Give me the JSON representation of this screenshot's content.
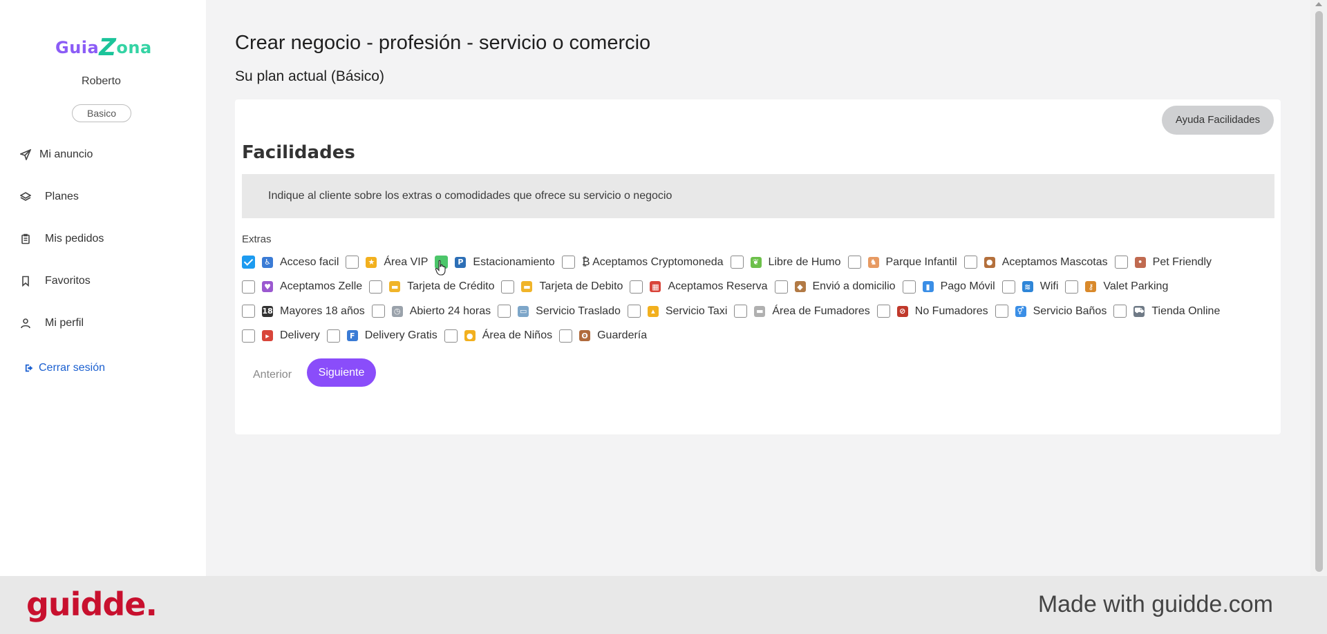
{
  "sidebar": {
    "logo": {
      "part1": "Guia",
      "part2": "Z",
      "part3": "ona"
    },
    "user_name": "Roberto",
    "plan_badge": "Basico",
    "nav": [
      {
        "label": "Mi anuncio",
        "icon": "send-icon"
      },
      {
        "label": "Planes",
        "icon": "layers-icon"
      },
      {
        "label": "Mis pedidos",
        "icon": "clipboard-icon"
      },
      {
        "label": "Favoritos",
        "icon": "bookmark-icon"
      },
      {
        "label": "Mi perfil",
        "icon": "user-icon"
      }
    ],
    "logout": "Cerrar sesión"
  },
  "main": {
    "title": "Crear negocio - profesión - servicio o comercio",
    "plan_line": "Su plan actual (Básico)",
    "help_button": "Ayuda Facilidades",
    "section_title": "Facilidades",
    "info": "Indique al cliente sobre los extras o comodidades que ofrece su servicio o negocio",
    "extras_label": "Extras",
    "rows": [
      [
        {
          "label": "Acceso facil",
          "checked": true,
          "icon": "wheelchair-icon",
          "color": "#3a7bd5",
          "glyph": "♿"
        },
        {
          "label": "Área VIP",
          "checked": false,
          "icon": "star-icon",
          "color": "#f2b01e",
          "glyph": "★"
        },
        {
          "label": "Estacionamiento",
          "checked": false,
          "hover": true,
          "icon": "parking-icon",
          "color": "#2d6fb6",
          "glyph": "P"
        },
        {
          "label": "₿ Aceptamos Cryptomoneda",
          "checked": false,
          "icon": "",
          "color": "",
          "glyph": ""
        },
        {
          "label": "Libre de Humo",
          "checked": false,
          "icon": "leaf-icon",
          "color": "#6cc04a",
          "glyph": "❦"
        },
        {
          "label": "Parque Infantil",
          "checked": false,
          "icon": "carousel-icon",
          "color": "#e79a62",
          "glyph": "♞"
        },
        {
          "label": "Aceptamos Mascotas",
          "checked": false,
          "icon": "dog-icon",
          "color": "#b4703c",
          "glyph": "●"
        },
        {
          "label": "Pet Friendly",
          "checked": false,
          "icon": "paw-icon",
          "color": "#c06a50",
          "glyph": "•"
        }
      ],
      [
        {
          "label": "Aceptamos Zelle",
          "checked": false,
          "icon": "purple-heart-icon",
          "color": "#9b59d0",
          "glyph": "♥"
        },
        {
          "label": "Tarjeta de Crédito",
          "checked": false,
          "icon": "credit-card-icon",
          "color": "#f0b429",
          "glyph": "▬"
        },
        {
          "label": "Tarjeta de Debito",
          "checked": false,
          "icon": "credit-card-icon",
          "color": "#f0b429",
          "glyph": "▬"
        },
        {
          "label": "Aceptamos Reserva",
          "checked": false,
          "icon": "calendar-icon",
          "color": "#d9443a",
          "glyph": "▦"
        },
        {
          "label": "Envió a domicilio",
          "checked": false,
          "icon": "package-icon",
          "color": "#b27a45",
          "glyph": "◆"
        },
        {
          "label": "Pago Móvil",
          "checked": false,
          "icon": "mobile-payment-icon",
          "color": "#3a8ee6",
          "glyph": "▮"
        },
        {
          "label": "Wifi",
          "checked": false,
          "icon": "wifi-icon",
          "color": "#2f86d8",
          "glyph": "≋"
        },
        {
          "label": "Valet Parking",
          "checked": false,
          "icon": "key-icon",
          "color": "#d9892b",
          "glyph": "⚷"
        }
      ],
      [
        {
          "label": "Mayores 18 años",
          "checked": false,
          "icon": "adults-only-icon",
          "color": "#333333",
          "glyph": "18"
        },
        {
          "label": "Abierto 24 horas",
          "checked": false,
          "icon": "clock-icon",
          "color": "#9aa2ab",
          "glyph": "◷"
        },
        {
          "label": "Servicio Traslado",
          "checked": false,
          "icon": "bus-icon",
          "color": "#7da6c9",
          "glyph": "▭"
        },
        {
          "label": "Servicio Taxi",
          "checked": false,
          "icon": "taxi-icon",
          "color": "#f2b01e",
          "glyph": "▴"
        },
        {
          "label": "Área de Fumadores",
          "checked": false,
          "icon": "cigarette-icon",
          "color": "#b0b0b0",
          "glyph": "▬"
        },
        {
          "label": "No Fumadores",
          "checked": false,
          "icon": "no-smoking-icon",
          "color": "#c0392b",
          "glyph": "⊘"
        },
        {
          "label": "Servicio Baños",
          "checked": false,
          "icon": "restroom-icon",
          "color": "#3a8ee6",
          "glyph": "⚥"
        },
        {
          "label": "Tienda Online",
          "checked": false,
          "icon": "cart-icon",
          "color": "#6f7a86",
          "glyph": "⛟"
        }
      ],
      [
        {
          "label": "Delivery",
          "checked": false,
          "icon": "scooter-icon",
          "color": "#d8453a",
          "glyph": "▸"
        },
        {
          "label": "Delivery Gratis",
          "checked": false,
          "icon": "free-icon",
          "color": "#3a7bd5",
          "glyph": "F"
        },
        {
          "label": "Área de Niños",
          "checked": false,
          "icon": "child-icon",
          "color": "#f2b01e",
          "glyph": "●"
        },
        {
          "label": "Guardería",
          "checked": false,
          "icon": "teddy-bear-icon",
          "color": "#b06a3c",
          "glyph": "ʘ"
        }
      ]
    ],
    "prev_button": "Anterior",
    "next_button": "Siguiente"
  },
  "footer": {
    "logo": "guidde.",
    "text": "Made with guidde.com"
  },
  "colors": {
    "accent": "#8a4dfa",
    "checkbox_checked": "#1d9bf0",
    "link": "#1a5fd0",
    "brand_red": "#c8102e"
  }
}
